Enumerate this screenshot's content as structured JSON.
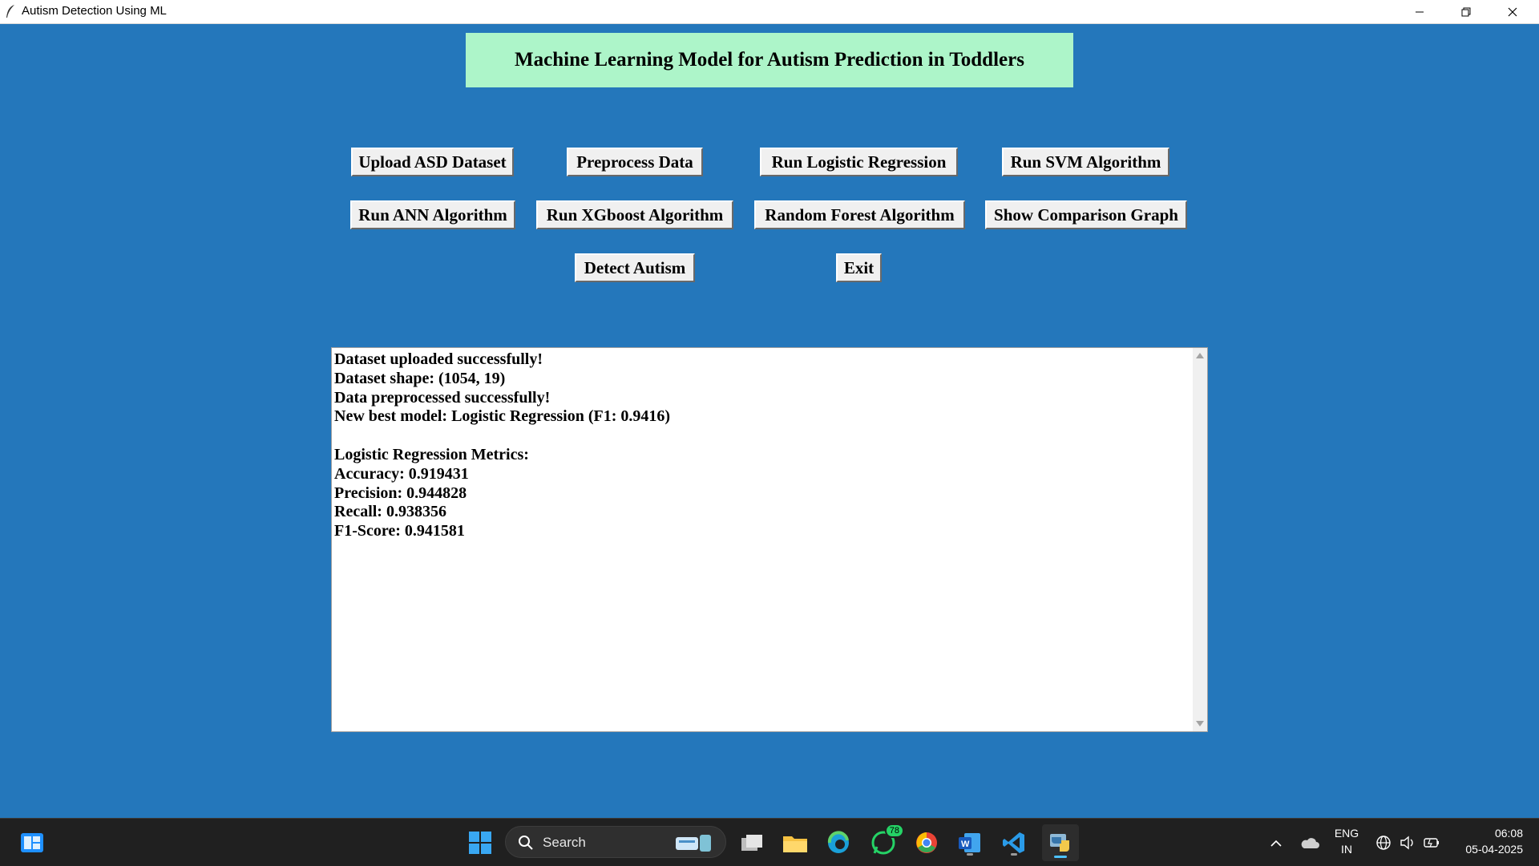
{
  "window": {
    "title": "Autism Detection Using ML",
    "minimize_icon": "minimize-icon",
    "restore_icon": "restore-icon",
    "close_icon": "close-icon"
  },
  "header": {
    "title": "Machine Learning Model for Autism Prediction in Toddlers"
  },
  "buttons": {
    "upload": "Upload ASD Dataset",
    "preprocess": "Preprocess Data",
    "logistic": "Run Logistic Regression",
    "svm": "Run SVM Algorithm",
    "ann": "Run ANN Algorithm",
    "xgboost": "Run XGboost Algorithm",
    "random_forest": "Random Forest Algorithm",
    "comparison": "Show Comparison Graph",
    "detect": "Detect Autism",
    "exit": "Exit"
  },
  "output": {
    "lines": [
      "Dataset uploaded successfully!",
      "Dataset shape: (1054, 19)",
      "Data preprocessed successfully!",
      "New best model: Logistic Regression (F1: 0.9416)",
      "",
      "Logistic Regression Metrics:",
      "Accuracy: 0.919431",
      "Precision: 0.944828",
      "Recall: 0.938356",
      "F1-Score: 0.941581"
    ]
  },
  "taskbar": {
    "search_label": "Search",
    "whatsapp_badge": "78",
    "language": "ENG",
    "region": "IN",
    "time": "06:08",
    "date": "05-04-2025"
  },
  "colors": {
    "background": "#2477bb",
    "heading_bg": "#adf5c9",
    "button_bg": "#f0f0f0",
    "taskbar_bg": "#202020"
  }
}
